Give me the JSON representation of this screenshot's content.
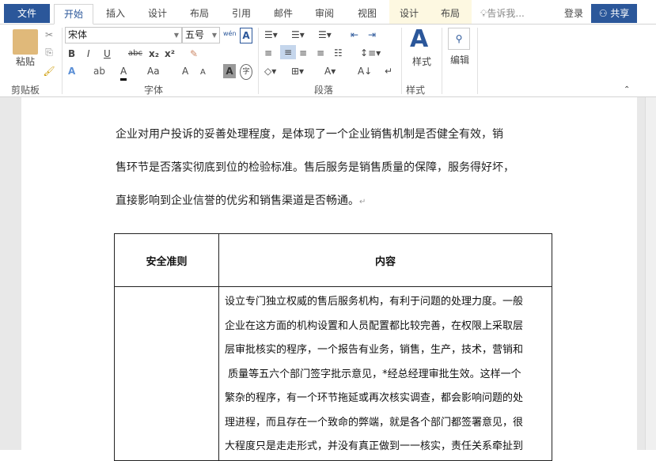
{
  "tabs": {
    "file": "文件",
    "home": "开始",
    "insert": "插入",
    "design": "设计",
    "layout": "布局",
    "references": "引用",
    "mailings": "邮件",
    "review": "审阅",
    "view": "视图",
    "table_design": "设计",
    "table_layout": "布局",
    "tell_me": "告诉我...",
    "signin": "登录",
    "share": "共享"
  },
  "ribbon": {
    "paste": "粘贴",
    "clipboard": "剪贴板",
    "font_name": "宋体",
    "font_size": "五号",
    "font_group": "字体",
    "paragraph_group": "段落",
    "styles": "样式",
    "styles_group": "样式",
    "editing": "编辑",
    "bold": "B",
    "italic": "I",
    "underline": "U",
    "strike": "abc",
    "subscript": "x₂",
    "superscript": "x²",
    "change_case": "Aa",
    "grow": "A",
    "shrink": "A",
    "shade": "A",
    "phonetic": "wén",
    "border_char": "A",
    "enclose": "字"
  },
  "document": {
    "paragraph": [
      "企业对用户投诉的妥善处理程度，是体现了一个企业销售机制是否健全有效，销",
      "售环节是否落实彻底到位的检验标准。售后服务是销售质量的保障，服务得好坏，",
      "直接影响到企业信誉的优劣和销售渠道是否畅通。"
    ],
    "table": {
      "headers": [
        "安全准则",
        "内容"
      ],
      "content_lines": [
        "设立专门独立权威的售后服务机构，有利于问题的处理力度。一般",
        "企业在这方面的机构设置和人员配置都比较完善，在权限上采取层",
        "层审批核实的程序，一个报告有业务，销售，生产，技术，营销和",
        " 质量等五六个部门签字批示意见，*经总经理审批生效。这样一个",
        "繁杂的程序，有一个环节拖延或再次核实调查，都会影响问题的处",
        "理进程，而且存在一个致命的弊端，就是各个部门都签署意见，很",
        "大程度只是走走形式，并没有真正做到一一核实，责任关系牵扯到"
      ]
    },
    "para_mark": "↵"
  }
}
